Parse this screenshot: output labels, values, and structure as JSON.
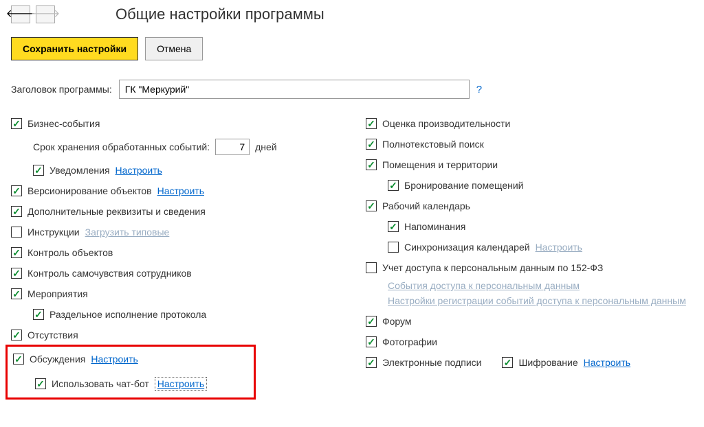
{
  "header": {
    "title": "Общие настройки программы"
  },
  "actions": {
    "save": "Сохранить настройки",
    "cancel": "Отмена"
  },
  "programTitle": {
    "label": "Заголовок программы:",
    "value": "ГК \"Меркурий\"",
    "help": "?"
  },
  "left": {
    "businessEvents": "Бизнес-события",
    "retentionLabel": "Срок хранения обработанных событий:",
    "retentionValue": "7",
    "retentionUnit": "дней",
    "notifications": "Уведомления",
    "configure1": "Настроить",
    "versioning": "Версионирование объектов",
    "configure2": "Настроить",
    "additionalProps": "Дополнительные реквизиты и сведения",
    "instructions": "Инструкции",
    "loadTypical": "Загрузить типовые",
    "objectControl": "Контроль объектов",
    "wellbeingControl": "Контроль самочувствия сотрудников",
    "events": "Мероприятия",
    "separateExecution": "Раздельное исполнение протокола",
    "absences": "Отсутствия",
    "discussions": "Обсуждения",
    "configure3": "Настроить",
    "useChatbot": "Использовать чат-бот",
    "configure4": "Настроить"
  },
  "right": {
    "perfEval": "Оценка производительности",
    "fulltextSearch": "Полнотекстовый поиск",
    "premises": "Помещения и территории",
    "roomBooking": "Бронирование помещений",
    "workCalendar": "Рабочий календарь",
    "reminders": "Напоминания",
    "calendarSync": "Синхронизация календарей",
    "configure5": "Настроить",
    "personalDataAccess": "Учет доступа к персональным данным по 152-ФЗ",
    "accessEvents": "События доступа к персональным данным",
    "registrationSettings": "Настройки регистрации событий доступа к персональным данным",
    "forum": "Форум",
    "photos": "Фотографии",
    "digitalSignatures": "Электронные подписи",
    "encryption": "Шифрование",
    "configure6": "Настроить"
  }
}
